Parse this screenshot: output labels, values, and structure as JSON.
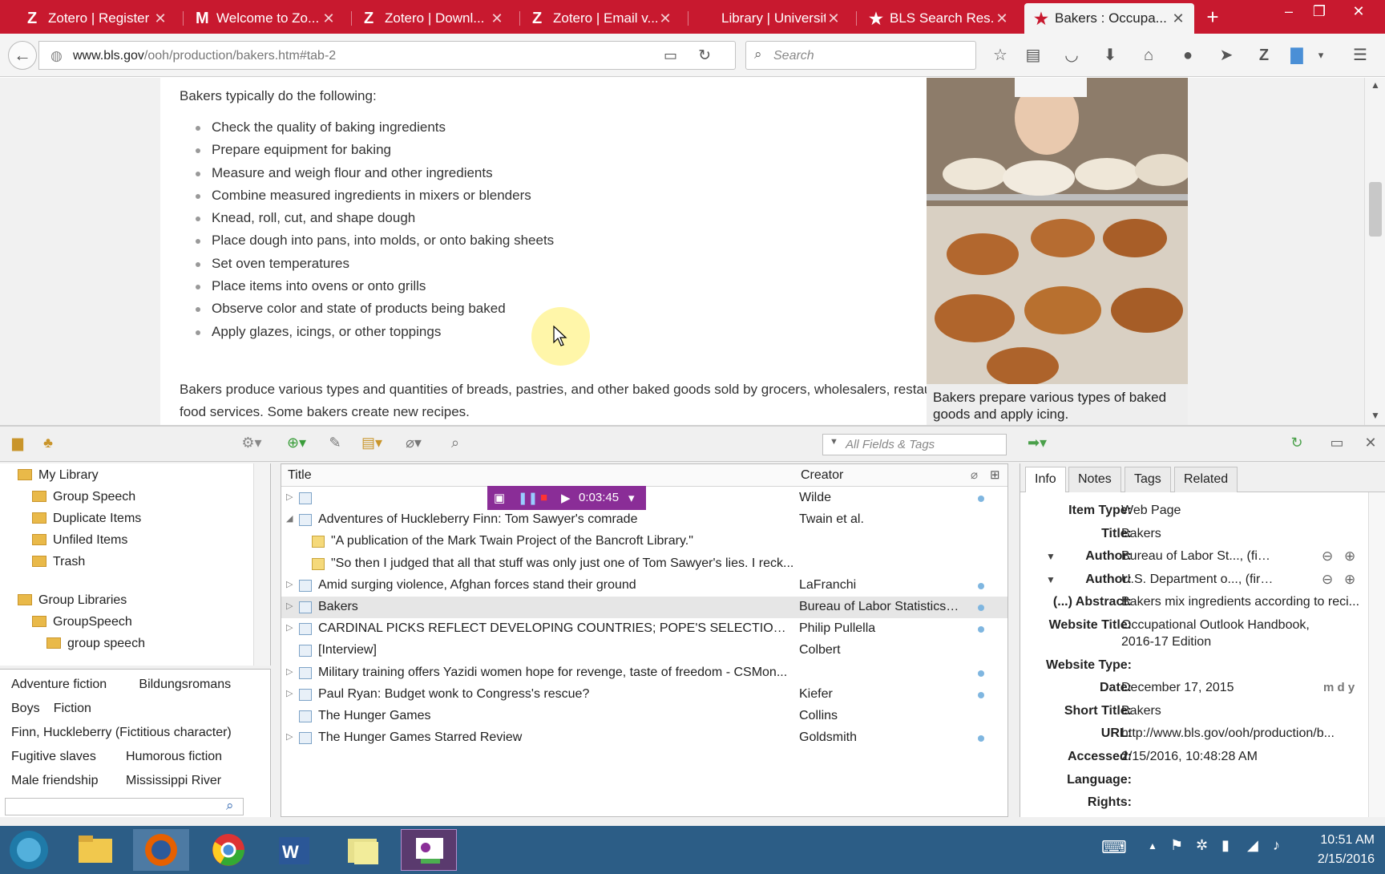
{
  "browser": {
    "tabs": [
      {
        "label": "Zotero | Register",
        "icon": "Z"
      },
      {
        "label": "Welcome to Zo...",
        "icon": "M"
      },
      {
        "label": "Zotero | Downl...",
        "icon": "Z"
      },
      {
        "label": "Zotero | Email v...",
        "icon": "Z"
      },
      {
        "label": "Library | University ...",
        "icon": ""
      },
      {
        "label": "BLS Search Res...",
        "icon": "★"
      },
      {
        "label": "Bakers : Occupa...",
        "icon": "★"
      }
    ],
    "url_host": "www.bls.gov",
    "url_path": "/ooh/production/bakers.htm#tab-2",
    "search_placeholder": "Search",
    "accent": "#c8192f"
  },
  "page": {
    "intro": "Bakers typically do the following:",
    "duties": [
      "Check the quality of baking ingredients",
      "Prepare equipment for baking",
      "Measure and weigh flour and other ingredients",
      "Combine measured ingredients in mixers or blenders",
      "Knead, roll, cut, and shape dough",
      "Place dough into pans, into molds, or onto baking sheets",
      "Set oven temperatures",
      "Place items into ovens or onto grills",
      "Observe color and state of products being baked",
      "Apply glazes, icings, or other toppings"
    ],
    "paragraph": "Bakers produce various types and quantities of breads, pastries, and other baked goods sold by grocers, wholesalers, restaurants, and institutional food services. Some bakers create new recipes.",
    "caption": "Bakers prepare various types of baked goods and apply icing."
  },
  "zotero": {
    "search_placeholder": "All Fields & Tags",
    "collections": [
      {
        "label": "My Library",
        "level": 0
      },
      {
        "label": "Group Speech",
        "level": 1
      },
      {
        "label": "Duplicate Items",
        "level": 1
      },
      {
        "label": "Unfiled Items",
        "level": 1
      },
      {
        "label": "Trash",
        "level": 1
      },
      {
        "label": "Group Libraries",
        "level": 0
      },
      {
        "label": "GroupSpeech",
        "level": 1
      },
      {
        "label": "group speech",
        "level": 2
      }
    ],
    "tags": [
      [
        "Adventure fiction",
        "Bildungsromans"
      ],
      [
        "Boys",
        "Fiction"
      ],
      [
        "Finn, Huckleberry (Fictitious character)"
      ],
      [
        "Fugitive slaves",
        "Humorous fiction"
      ],
      [
        "Male friendship",
        "Mississippi River"
      ]
    ],
    "columns": {
      "title": "Title",
      "creator": "Creator"
    },
    "recorder_time": "0:03:45",
    "items": [
      {
        "title": "",
        "creator": "Wilde",
        "twisty": "▷",
        "dot": true
      },
      {
        "title": "Adventures of Huckleberry Finn: Tom Sawyer's comrade",
        "creator": "Twain et al.",
        "twisty": "◢",
        "dot": false
      },
      {
        "title": "\"A publication of the Mark Twain Project of the Bancroft Library.\"",
        "creator": "",
        "twisty": "",
        "dot": false,
        "note": true
      },
      {
        "title": "\"So then I judged that all that stuff was only just one of Tom Sawyer's lies. I reck...",
        "creator": "",
        "twisty": "",
        "dot": false,
        "note": true
      },
      {
        "title": "Amid surging violence, Afghan forces stand their ground",
        "creator": "LaFranchi",
        "twisty": "▷",
        "dot": true
      },
      {
        "title": "Bakers",
        "creator": "Bureau of Labor Statistics a...",
        "twisty": "▷",
        "dot": true,
        "selected": true
      },
      {
        "title": "CARDINAL PICKS REFLECT DEVELOPING COUNTRIES; POPE'S SELECTIONS SHIFT ...",
        "creator": "Philip Pullella",
        "twisty": "▷",
        "dot": true
      },
      {
        "title": "[Interview]",
        "creator": "Colbert",
        "twisty": "",
        "dot": false
      },
      {
        "title": "Military training offers Yazidi women hope for revenge, taste of freedom - CSMon...",
        "creator": "",
        "twisty": "▷",
        "dot": true
      },
      {
        "title": "Paul Ryan: Budget wonk to Congress's rescue?",
        "creator": "Kiefer",
        "twisty": "▷",
        "dot": true
      },
      {
        "title": "The Hunger Games",
        "creator": "Collins",
        "twisty": "",
        "dot": false
      },
      {
        "title": "The Hunger Games Starred Review",
        "creator": "Goldsmith",
        "twisty": "▷",
        "dot": true
      }
    ],
    "info_tabs": [
      "Info",
      "Notes",
      "Tags",
      "Related"
    ],
    "fields": [
      {
        "label": "Item Type:",
        "value": "Web Page"
      },
      {
        "label": "Title:",
        "value": "Bakers"
      },
      {
        "label": "Author:",
        "value": "Bureau of Labor St..., (first)",
        "author": true
      },
      {
        "label": "Author:",
        "value": "U.S. Department o..., (first)",
        "author": true
      },
      {
        "label": "(...) Abstract:",
        "value": "Bakers mix ingredients according to reci..."
      },
      {
        "label": "Website Title:",
        "value": "Occupational Outlook Handbook,",
        "value2": "2016-17 Edition"
      },
      {
        "label": "Website Type:",
        "value": ""
      },
      {
        "label": "Date:",
        "value": "December 17, 2015",
        "extra": "m d y"
      },
      {
        "label": "Short Title:",
        "value": "Bakers"
      },
      {
        "label": "URL:",
        "value": "http://www.bls.gov/ooh/production/b..."
      },
      {
        "label": "Accessed:",
        "value": "2/15/2016, 10:48:28 AM"
      },
      {
        "label": "Language:",
        "value": ""
      },
      {
        "label": "Rights:",
        "value": ""
      }
    ]
  },
  "taskbar": {
    "time": "10:51 AM",
    "date": "2/15/2016",
    "color": "#2c5d86"
  }
}
